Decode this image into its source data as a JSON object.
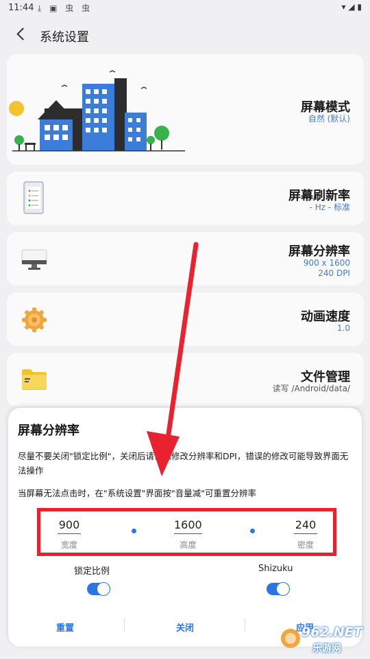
{
  "status_bar": {
    "time": "11:44",
    "left_icons": "⤓ ▣ 虫 虫",
    "right_icons": "▾ ◢ ▮"
  },
  "header": {
    "title": "系统设置"
  },
  "cards": [
    {
      "title": "屏幕模式",
      "subtitle": "自然 (默认)"
    },
    {
      "title": "屏幕刷新率",
      "subtitle": "- Hz - 标准"
    },
    {
      "title": "屏幕分辨率",
      "subtitle_line1": "900 x 1600",
      "subtitle_line2": "240 DPI"
    },
    {
      "title": "动画速度",
      "subtitle": "1.0"
    },
    {
      "title": "文件管理",
      "subtitle": "读写 /Android/data/"
    }
  ],
  "dialog": {
    "title": "屏幕分辨率",
    "warning": "尽量不要关闭\"锁定比例\"，关闭后请谨慎修改分辨率和DPI，错误的修改可能导致界面无法操作",
    "hint": "当屏幕无法点击时，在\"系统设置\"界面按\"音量减\"可重置分辨率",
    "fields": [
      {
        "value": "900",
        "label": "宽度"
      },
      {
        "value": "1600",
        "label": "高度"
      },
      {
        "value": "240",
        "label": "密度"
      }
    ],
    "switches": [
      {
        "label": "锁定比例",
        "on": true
      },
      {
        "label": "Shizuku",
        "on": true
      }
    ],
    "buttons": {
      "reset": "重置",
      "close": "关闭",
      "apply": "应用"
    }
  },
  "watermark": {
    "text": "962.NET",
    "subtext": "乐游网"
  },
  "colors": {
    "accent": "#2b76e5",
    "annotation_red": "#e8232f"
  }
}
